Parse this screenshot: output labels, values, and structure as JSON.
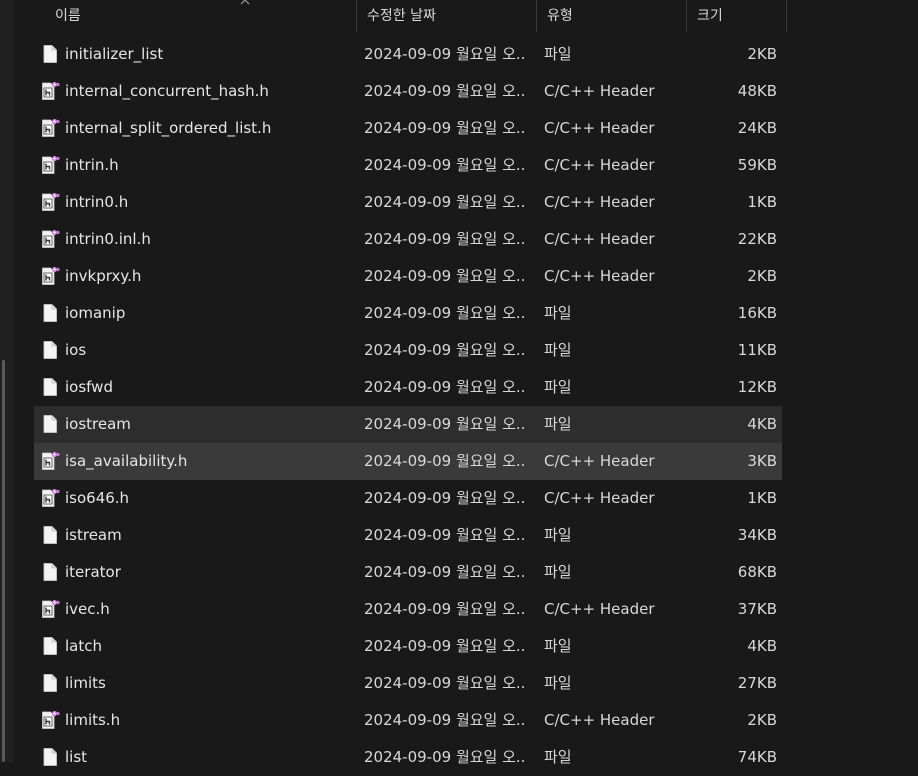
{
  "columns": {
    "name": "이름",
    "date": "수정한 날짜",
    "type": "유형",
    "size": "크기"
  },
  "files": [
    {
      "name": "initializer_list",
      "date": "2024-09-09 월요일 오...",
      "type": "파일",
      "size": "2KB",
      "icon": "file-icon"
    },
    {
      "name": "internal_concurrent_hash.h",
      "date": "2024-09-09 월요일 오...",
      "type": "C/C++ Header",
      "size": "48KB",
      "icon": "header-file-icon"
    },
    {
      "name": "internal_split_ordered_list.h",
      "date": "2024-09-09 월요일 오...",
      "type": "C/C++ Header",
      "size": "24KB",
      "icon": "header-file-icon"
    },
    {
      "name": "intrin.h",
      "date": "2024-09-09 월요일 오...",
      "type": "C/C++ Header",
      "size": "59KB",
      "icon": "header-file-icon"
    },
    {
      "name": "intrin0.h",
      "date": "2024-09-09 월요일 오...",
      "type": "C/C++ Header",
      "size": "1KB",
      "icon": "header-file-icon"
    },
    {
      "name": "intrin0.inl.h",
      "date": "2024-09-09 월요일 오...",
      "type": "C/C++ Header",
      "size": "22KB",
      "icon": "header-file-icon"
    },
    {
      "name": "invkprxy.h",
      "date": "2024-09-09 월요일 오...",
      "type": "C/C++ Header",
      "size": "2KB",
      "icon": "header-file-icon"
    },
    {
      "name": "iomanip",
      "date": "2024-09-09 월요일 오...",
      "type": "파일",
      "size": "16KB",
      "icon": "file-icon"
    },
    {
      "name": "ios",
      "date": "2024-09-09 월요일 오...",
      "type": "파일",
      "size": "11KB",
      "icon": "file-icon"
    },
    {
      "name": "iosfwd",
      "date": "2024-09-09 월요일 오...",
      "type": "파일",
      "size": "12KB",
      "icon": "file-icon"
    },
    {
      "name": "iostream",
      "date": "2024-09-09 월요일 오...",
      "type": "파일",
      "size": "4KB",
      "icon": "file-icon",
      "state": "hover"
    },
    {
      "name": "isa_availability.h",
      "date": "2024-09-09 월요일 오...",
      "type": "C/C++ Header",
      "size": "3KB",
      "icon": "header-file-icon",
      "state": "selected"
    },
    {
      "name": "iso646.h",
      "date": "2024-09-09 월요일 오...",
      "type": "C/C++ Header",
      "size": "1KB",
      "icon": "header-file-icon"
    },
    {
      "name": "istream",
      "date": "2024-09-09 월요일 오...",
      "type": "파일",
      "size": "34KB",
      "icon": "file-icon"
    },
    {
      "name": "iterator",
      "date": "2024-09-09 월요일 오...",
      "type": "파일",
      "size": "68KB",
      "icon": "file-icon"
    },
    {
      "name": "ivec.h",
      "date": "2024-09-09 월요일 오...",
      "type": "C/C++ Header",
      "size": "37KB",
      "icon": "header-file-icon"
    },
    {
      "name": "latch",
      "date": "2024-09-09 월요일 오...",
      "type": "파일",
      "size": "4KB",
      "icon": "file-icon"
    },
    {
      "name": "limits",
      "date": "2024-09-09 월요일 오...",
      "type": "파일",
      "size": "27KB",
      "icon": "file-icon"
    },
    {
      "name": "limits.h",
      "date": "2024-09-09 월요일 오...",
      "type": "C/C++ Header",
      "size": "2KB",
      "icon": "header-file-icon"
    },
    {
      "name": "list",
      "date": "2024-09-09 월요일 오...",
      "type": "파일",
      "size": "74KB",
      "icon": "file-icon"
    }
  ],
  "colors": {
    "background": "#191919",
    "hover": "#2d2d2d",
    "selected": "#3a3a3a",
    "header_badge": "#c77dd8"
  }
}
